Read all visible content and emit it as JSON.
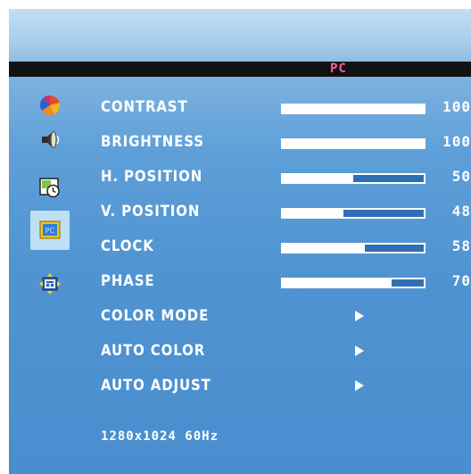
{
  "header": {
    "title": "PC"
  },
  "menu": [
    {
      "label": "CONTRAST",
      "value": "100",
      "level": 1.0
    },
    {
      "label": "BRIGHTNESS",
      "value": "100",
      "level": 1.0
    },
    {
      "label": "H. POSITION",
      "value": "50",
      "level": 0.5
    },
    {
      "label": "V. POSITION",
      "value": "48",
      "level": 0.43
    },
    {
      "label": "CLOCK",
      "value": "58",
      "level": 0.58
    },
    {
      "label": "PHASE",
      "value": "70",
      "level": 0.77
    },
    {
      "label": "COLOR MODE"
    },
    {
      "label": "AUTO COLOR"
    },
    {
      "label": "AUTO ADJUST"
    }
  ],
  "sidebar": {
    "icons": [
      "color-wheel-icon",
      "speaker-icon",
      "clock-window-icon",
      "pc-monitor-icon",
      "screen-position-icon"
    ],
    "selected": "pc-monitor-icon"
  },
  "status": {
    "resolution": "1280x1024 60Hz"
  },
  "colors": {
    "header_text": "#ff5c8a",
    "header_band": "#121212",
    "panel": "#5e9fd8"
  }
}
